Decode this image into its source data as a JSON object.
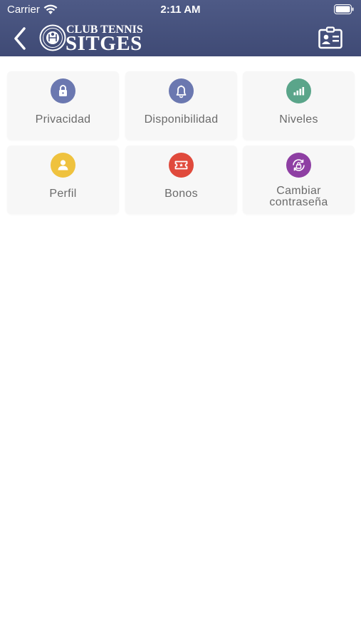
{
  "status_bar": {
    "carrier": "Carrier",
    "time": "2:11 AM"
  },
  "header": {
    "logo_line1": "CLUB TENNIS",
    "logo_line2": "SITGES",
    "background_color": "#47527e"
  },
  "menu": {
    "items": [
      {
        "label": "Privacidad",
        "icon": "lock-icon",
        "color": "#6b78b0"
      },
      {
        "label": "Disponibilidad",
        "icon": "bell-icon",
        "color": "#6b78b0"
      },
      {
        "label": "Niveles",
        "icon": "signal-bars-icon",
        "color": "#5aa58a"
      },
      {
        "label": "Perfil",
        "icon": "user-icon",
        "color": "#efc23e"
      },
      {
        "label": "Bonos",
        "icon": "ticket-icon",
        "color": "#e04a3c"
      },
      {
        "label": "Cambiar contraseña",
        "icon": "lock-refresh-icon",
        "color": "#8e3fa3"
      }
    ]
  }
}
